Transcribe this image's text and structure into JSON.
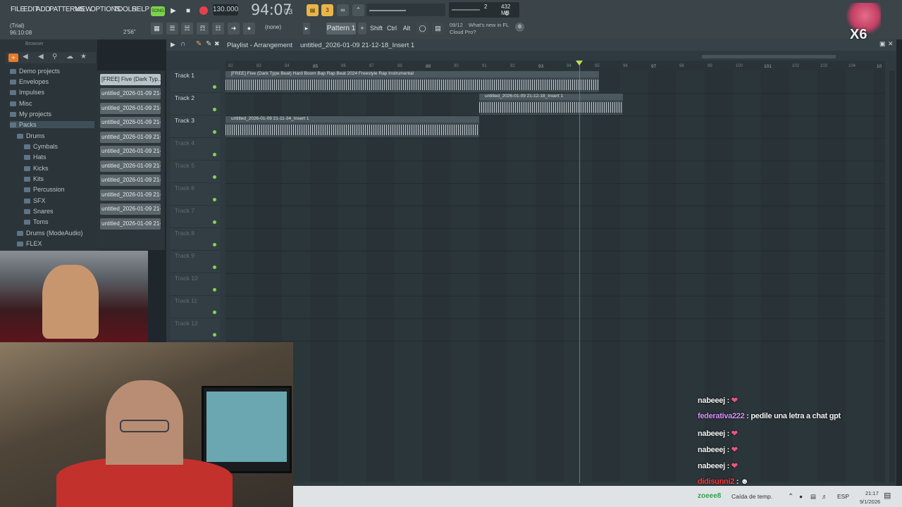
{
  "menu": [
    "FILE",
    "EDIT",
    "ADD",
    "PATTERNS",
    "VIEW",
    "OPTIONS",
    "TOOLS",
    "HELP"
  ],
  "song_label": "SONG",
  "tempo": "130.000",
  "time": {
    "main": "94:07",
    "sub": "03"
  },
  "meter": {
    "top": "2",
    "mem": "432 MB",
    "zero": "0"
  },
  "trial": "(Trial)",
  "time_code": "96:10:08",
  "duration": "2'56\"",
  "none_label": "(none)",
  "pattern_label": "Pattern 1",
  "keys": [
    "Shift",
    "Ctrl",
    "Alt"
  ],
  "news": {
    "date": "09/12",
    "line1": "What's new in FL",
    "line2": "Cloud Pro?"
  },
  "x6": "X6",
  "browser": {
    "title": "Browser",
    "items": [
      "Demo projects",
      "Envelopes",
      "Impulses",
      "Misc",
      "My projects",
      "Packs",
      "Drums",
      "Cymbals",
      "Hats",
      "Kicks",
      "Kits",
      "Percussion",
      "SFX",
      "Snares",
      "Toms",
      "Drums (ModeAudio)",
      "FLEX"
    ]
  },
  "channels": [
    "[FREE] Five (Dark Typ...",
    "untitled_2026-01-09 21-...",
    "untitled_2026-01-09 21-...",
    "untitled_2026-01-09 21-...",
    "untitled_2026-01-09 21-...",
    "untitled_2026-01-09 21-...",
    "untitled_2026-01-09 21-...",
    "untitled_2026-01-09 21-...",
    "untitled_2026-01-09 21-...",
    "untitled_2026-01-09 21-...",
    "untitled_2026-01-09 21-..."
  ],
  "playlist": {
    "title": "Playlist - Arrangement",
    "file": "untitled_2026-01-09 21-12-18_Insert 1",
    "tracks": [
      "Track 1",
      "Track 2",
      "Track 3",
      "Track 4",
      "Track 5",
      "Track 6",
      "Track 7",
      "Track 8",
      "Track 9",
      "Track 10",
      "Track 11",
      "Track 12"
    ],
    "ruler": [
      "82",
      "83",
      "84",
      "85",
      "86",
      "87",
      "88",
      "89",
      "90",
      "91",
      "92",
      "93",
      "94",
      "95",
      "96",
      "97",
      "98",
      "99",
      "100",
      "101",
      "102",
      "103",
      "104",
      "10"
    ],
    "clips": [
      {
        "label": "[FREE] Five (Dark Type Beat) Hard Boom Bap Rap Beat 2024 Freestyle Rap Instrumental"
      },
      {
        "label": "untitled_2026-01-09 21-12-18_Insert 1"
      },
      {
        "label": "untitled_2026-01-09 21-11-34_Insert 1"
      }
    ]
  },
  "chat": [
    {
      "user": "nabeeej",
      "msg": "",
      "color": "#e6e9ec"
    },
    {
      "user": "federativa222",
      "msg": "pedile una letra a chat gpt",
      "color": "#d991ff"
    },
    {
      "user": "nabeeej",
      "msg": "",
      "color": "#e6e9ec"
    },
    {
      "user": "nabeeej",
      "msg": "",
      "color": "#e6e9ec"
    },
    {
      "user": "nabeeej",
      "msg": "",
      "color": "#e6e9ec"
    },
    {
      "user": "didisunni2",
      "msg": "",
      "color": "#ff3b3b"
    }
  ],
  "taskbar": {
    "user": "zoeee8",
    "weather": "Caída de temp.",
    "lang": "ESP",
    "clock": "21:17",
    "date": "9/1/2026"
  }
}
